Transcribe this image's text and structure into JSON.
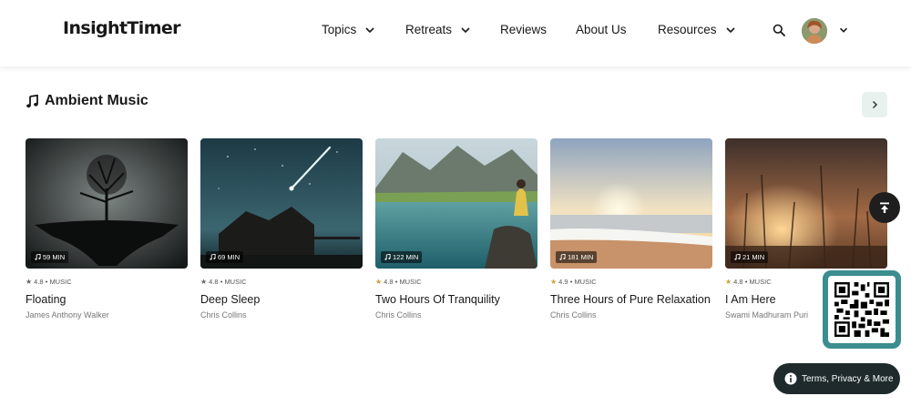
{
  "header": {
    "logo": "InsightTimer",
    "nav": [
      {
        "label": "Topics",
        "has_dropdown": true
      },
      {
        "label": "Retreats",
        "has_dropdown": true
      },
      {
        "label": "Reviews",
        "has_dropdown": false
      },
      {
        "label": "About Us",
        "has_dropdown": false
      },
      {
        "label": "Resources",
        "has_dropdown": true
      }
    ],
    "search_icon": "search-icon",
    "avatar_icon": "user-avatar"
  },
  "section": {
    "title": "Ambient Music",
    "icon": "music-note-icon"
  },
  "cards": [
    {
      "duration": "59 MIN",
      "rating": "4.8",
      "type": "MUSIC",
      "title": "Floating",
      "author": "James Anthony Walker"
    },
    {
      "duration": "69 MIN",
      "rating": "4.8",
      "type": "MUSIC",
      "title": "Deep Sleep",
      "author": "Chris Collins"
    },
    {
      "duration": "122 MIN",
      "rating": "4.8",
      "type": "MUSIC",
      "title": "Two Hours Of Tranquility",
      "author": "Chris Collins"
    },
    {
      "duration": "181 MIN",
      "rating": "4.9",
      "type": "MUSIC",
      "title": "Three Hours of Pure Relaxation",
      "author": "Chris Collins"
    },
    {
      "duration": "21 MIN",
      "rating": "4.8",
      "type": "MUSIC",
      "title": "I Am Here",
      "author": "Swami Madhuram Puri"
    }
  ],
  "meta_separator": "•",
  "star_char": "★",
  "floating": {
    "terms_label": "Terms, Privacy & More"
  },
  "colors": {
    "accent": "#3b8d8f",
    "star": "#c9a23a",
    "text": "#181818"
  }
}
